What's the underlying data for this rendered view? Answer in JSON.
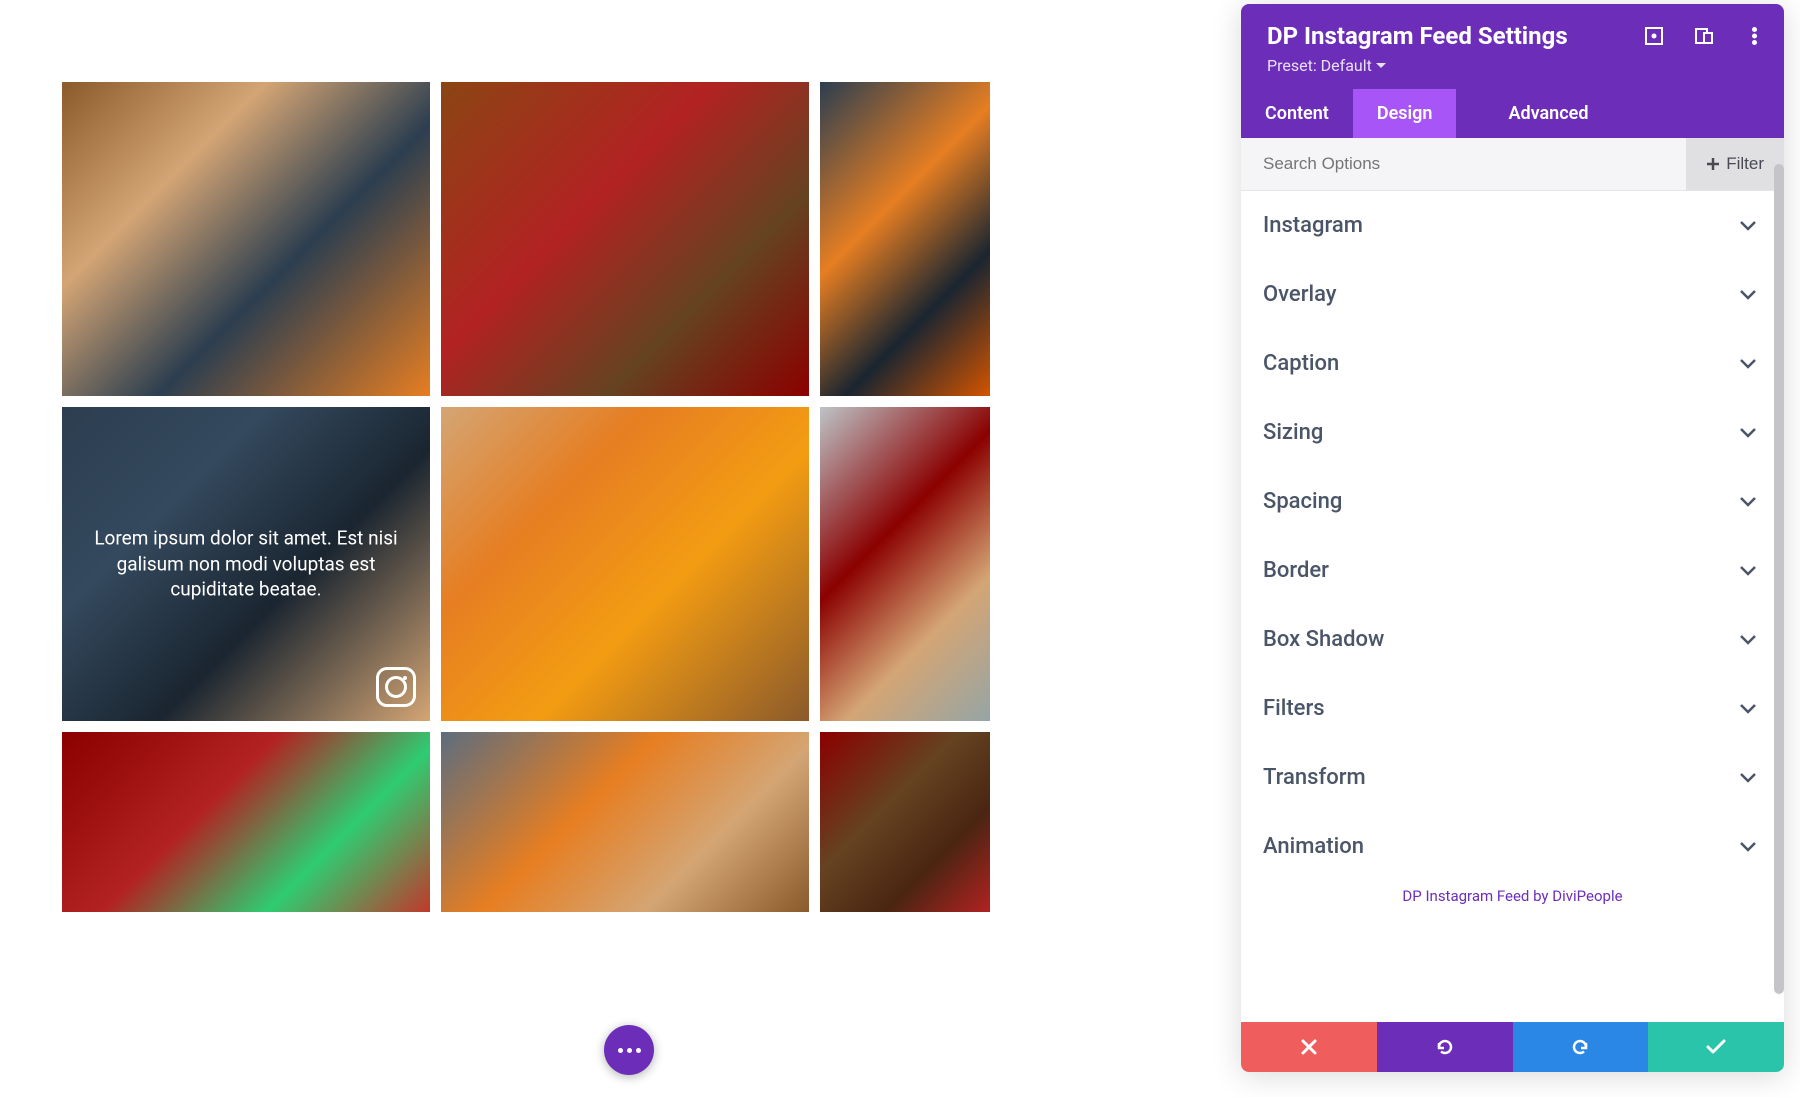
{
  "overlay": {
    "caption": "Lorem ipsum dolor sit amet. Est nisi galisum non modi voluptas est cupiditate beatae."
  },
  "panel": {
    "title": "DP Instagram Feed Settings",
    "preset_label": "Preset: Default",
    "tabs": {
      "content": "Content",
      "design": "Design",
      "advanced": "Advanced"
    },
    "search_placeholder": "Search Options",
    "filter_label": "Filter",
    "options": [
      "Instagram",
      "Overlay",
      "Caption",
      "Sizing",
      "Spacing",
      "Border",
      "Box Shadow",
      "Filters",
      "Transform",
      "Animation"
    ],
    "footer_link": "DP Instagram Feed by DiviPeople"
  }
}
